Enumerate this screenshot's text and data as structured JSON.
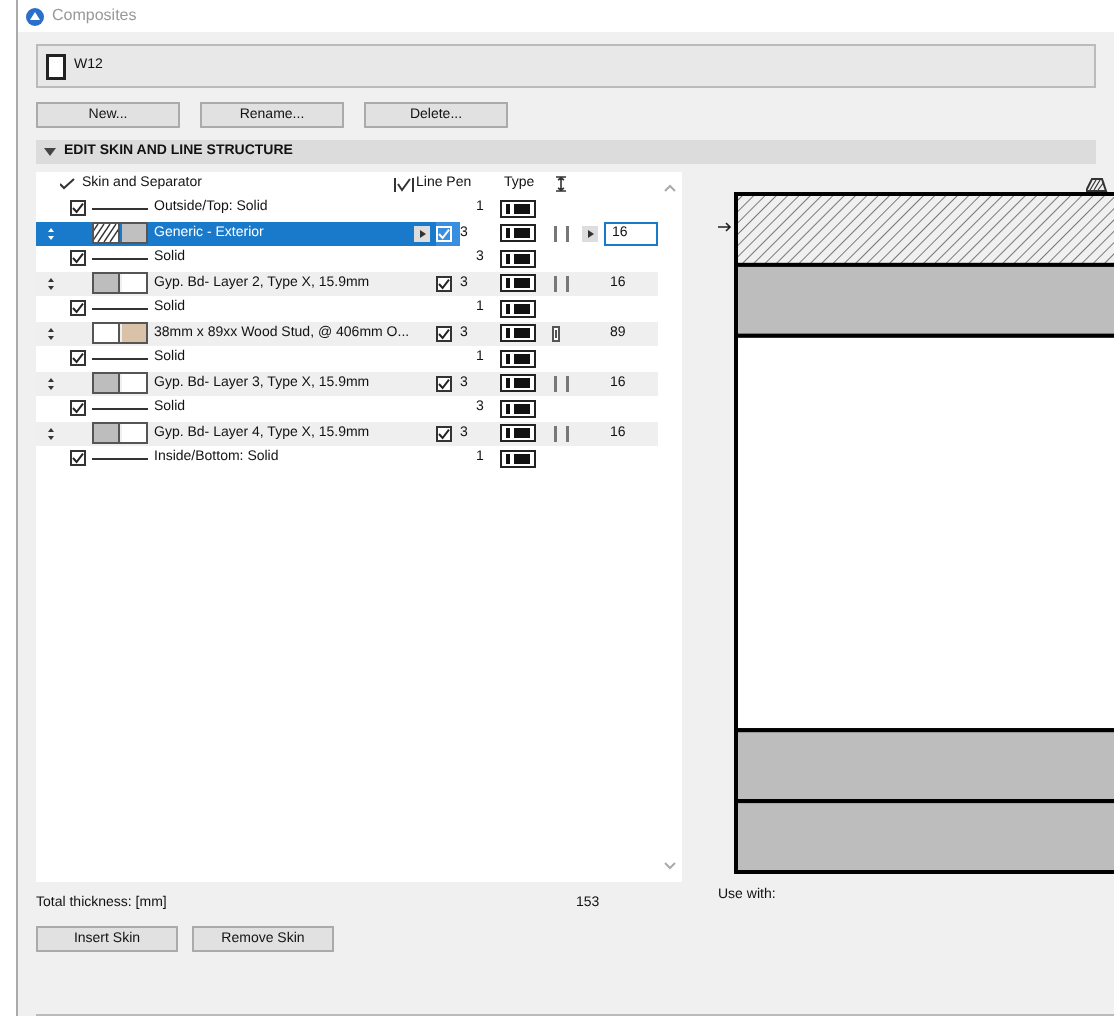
{
  "window": {
    "title": "Composites"
  },
  "composite": {
    "name": "W12"
  },
  "buttons": [
    "New...",
    "Rename...",
    "Delete..."
  ],
  "section": {
    "title": "EDIT SKIN AND LINE STRUCTURE",
    "expanded": true
  },
  "table": {
    "columns": [
      "Skin and Separator",
      "Line Pen",
      "Type"
    ],
    "rows": [
      {
        "kind": "line",
        "checked": true,
        "selected": false,
        "name": "Outside/Top: Solid",
        "pen": "1"
      },
      {
        "kind": "skin",
        "checked": true,
        "selected": true,
        "name": "Generic - Exterior",
        "swatch": {
          "kind": "hatch",
          "color": "#c0c0c0"
        },
        "pen": "3",
        "thickness": "16"
      },
      {
        "kind": "line",
        "checked": true,
        "selected": false,
        "name": "Solid",
        "pen": "3"
      },
      {
        "kind": "skin",
        "checked": true,
        "selected": false,
        "name": "Gyp. Bd- Layer 2, Type X, 15.9mm",
        "swatch": {
          "kind": "gray",
          "color": "#ffffff"
        },
        "pen": "3",
        "thickness": "16"
      },
      {
        "kind": "line",
        "checked": true,
        "selected": false,
        "name": "Solid",
        "pen": "1"
      },
      {
        "kind": "skin",
        "checked": true,
        "selected": false,
        "name": "38mm x 89xx Wood Stud, @ 406mm O...",
        "swatch": {
          "kind": "blank",
          "color": "#d9c2a8"
        },
        "pen": "3",
        "thickness": "89"
      },
      {
        "kind": "line",
        "checked": true,
        "selected": false,
        "name": "Solid",
        "pen": "1"
      },
      {
        "kind": "skin",
        "checked": true,
        "selected": false,
        "name": "Gyp. Bd- Layer 3, Type X, 15.9mm",
        "swatch": {
          "kind": "gray",
          "color": "#ffffff"
        },
        "pen": "3",
        "thickness": "16"
      },
      {
        "kind": "line",
        "checked": true,
        "selected": false,
        "name": "Solid",
        "pen": "3"
      },
      {
        "kind": "skin",
        "checked": true,
        "selected": false,
        "name": "Gyp. Bd- Layer 4, Type X, 15.9mm",
        "swatch": {
          "kind": "gray",
          "color": "#ffffff"
        },
        "pen": "3",
        "thickness": "16"
      },
      {
        "kind": "line",
        "checked": true,
        "selected": false,
        "name": "Inside/Bottom: Solid",
        "pen": "1"
      }
    ]
  },
  "total": {
    "label": "Total thickness: [mm]",
    "value": "153"
  },
  "actions": [
    "Insert Skin",
    "Remove Skin"
  ],
  "use_with": {
    "label": "Use with:"
  }
}
